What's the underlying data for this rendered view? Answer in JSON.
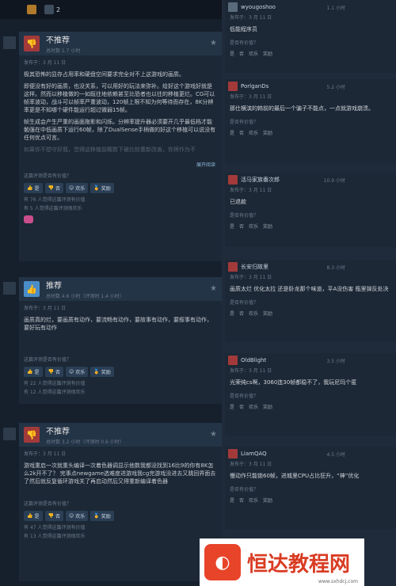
{
  "topbar": {
    "count": "2"
  },
  "reviews": [
    {
      "verdict": "不推荐",
      "hours": "总时数 1.7 小时",
      "posted": "发布于：3 月 11 日",
      "paragraphs": [
        "极其恐怖的显存占用率和硬盘空间要求完全对不上这游戏的画质。",
        "即便没有好的画质，也没关系，可以用好的玩法来弥补。给好这个游戏好就是这样。然而以移植做的一如既往地依赖甚至比恐者也以往的移植更烂。CG可以帧率波动，战斗可以帧率严重波动，120帧上限不知为何等待而存在，8K分辨率更是不知哪个硬件能运行超过微弱15帧。",
        "帧生成会产生严重的画面拖影和闪烁。分辨率提升器必须要开几乎最低档才能勉强在中低画质下运行60帧，除了DualSense手柄做的好这个移植可以说没有任何优点可言。",
        "如果你不想守好我，觉得这移植前瞻数下被比较重新改善，你将作为不"
      ],
      "expand": "展开阅读",
      "helpful_q": "这篇评测是否有价值？",
      "btn_yes": "是",
      "btn_no": "否",
      "btn_funny": "欢乐",
      "btn_award": "奖励",
      "count1": "有 76 人觉得这篇评测有价值",
      "count2": "有 5 人觉得这篇评测很欢乐"
    },
    {
      "verdict": "推荐",
      "hours": "总时数 4.6 小时（评测时 1.4 小时）",
      "posted": "发布于：3 月 11 日",
      "paragraphs": [
        "画质真的烂，要画质有动作，要流畅有动作，要故事有动作，要叙事有动作，要好玩有动作"
      ],
      "helpful_q": "这篇评测是否有价值？",
      "btn_yes": "是",
      "btn_no": "否",
      "btn_funny": "欢乐",
      "btn_award": "奖励",
      "count1": "有 22 人觉得这篇评测有价值",
      "count2": "有 12 人觉得这篇评测很欢乐"
    },
    {
      "verdict": "不推荐",
      "hours": "总时数 3.2 小时（评测时 0.6 小时）",
      "posted": "发布于：3 月 11 日",
      "paragraphs": [
        "游戏重启一次就重头编译一次着色器调显示他数我都没找到16比9的你有8K怎么2k开不了？ 完事点newgame选难度进游戏我cg完游戏没进去又跳回界面去了然后就反复循环游戏关了再启动然后又得重新编译着色器"
      ],
      "helpful_q": "这篇评测是否有价值？",
      "btn_yes": "是",
      "btn_no": "否",
      "btn_funny": "欢乐",
      "btn_award": "奖励",
      "count1": "有 47 人觉得这篇评测有价值",
      "count2": "有 13 人觉得这篇评测很欢乐"
    }
  ],
  "comments": [
    {
      "name": "wyougoshoo",
      "hours": "1.1 小时",
      "posted": "发布于：3 月 11 日",
      "text": "低能程序员",
      "helpful_q": "是否有价值？"
    },
    {
      "name": "PorlganDs",
      "hours": "5.2 小时",
      "posted": "发布于：3 月 11 日",
      "text": "那仕横滨的韩前的最后一个骗子不能点，一点就游戏崩溃。",
      "helpful_q": "是否有价值？"
    },
    {
      "name": "活马家族番次郎",
      "hours": "10.9 小时",
      "posted": "发布于：3 月 11 日",
      "text": "已退款",
      "helpful_q": "是否有价值？"
    },
    {
      "name": "长安归故里",
      "hours": "8.3 小时",
      "posted": "发布于：3 月 11 日",
      "text": "画质太烂 优化太拉 还是卧龙那个味道，平A没伤害 瓶里弹反处决",
      "helpful_q": "是否有价值？"
    },
    {
      "name": "OldBlight",
      "hours": "3.5 小时",
      "posted": "发布于：3 月 11 日",
      "text": "光荣纯cs啊，3060连30帧都稳不了，我玩尼玛个匿",
      "helpful_q": "是否有价值？"
    },
    {
      "name": "LiamQAQ",
      "hours": "4.5 小时",
      "posted": "发布于：3 月 11 日",
      "text": "慢动作只能锁60帧，进城里CPU占比狂升，“神”优化",
      "helpful_q": "是否有价值？"
    }
  ],
  "vote_labels": {
    "yes": "是",
    "no": "否",
    "funny": "欢乐",
    "award": "奖励"
  },
  "watermark": {
    "text": "恒达教程网",
    "url": "www.sxhdcj.com"
  }
}
